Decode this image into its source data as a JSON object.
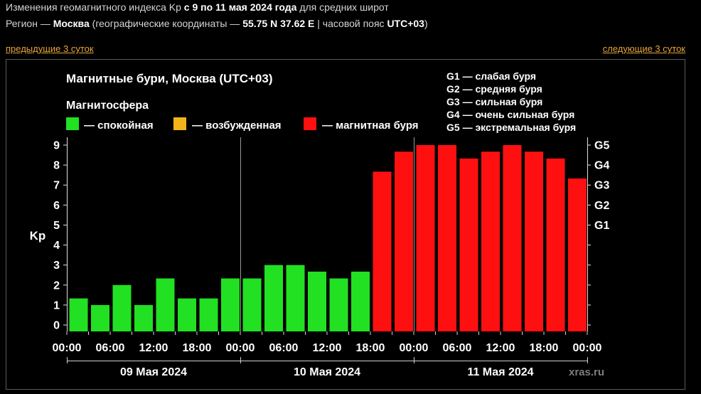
{
  "header": {
    "intro": "Изменения геомагнитного индекса Kp ",
    "period": "с 9 по 11 мая 2024 года",
    "latitudes": " для средних широт",
    "region_label": "Регион — ",
    "region": "Москва",
    "coords_label": " (географические координаты — ",
    "coords": "55.75 N 37.62 E",
    "tz_label": " | часовой пояс ",
    "timezone": "UTC+03",
    "close": ")"
  },
  "nav": {
    "prev": "предыдущие 3 суток",
    "next": "следующие 3 суток"
  },
  "chart_data": {
    "type": "bar",
    "title": "Магнитные бури, Москва (UTC+03)",
    "ylabel": "Kp",
    "ylim": [
      0,
      9
    ],
    "yticks": [
      0,
      1,
      2,
      3,
      4,
      5,
      6,
      7,
      8,
      9
    ],
    "y2ticks": [
      {
        "value": 5,
        "label": "G1"
      },
      {
        "value": 6,
        "label": "G2"
      },
      {
        "value": 7,
        "label": "G3"
      },
      {
        "value": 8,
        "label": "G4"
      },
      {
        "value": 9,
        "label": "G5"
      }
    ],
    "legend": {
      "title": "Магнитосфера",
      "position": "top-left",
      "items": [
        {
          "label": "— спокойная",
          "color": "#22e022"
        },
        {
          "label": "— возбужденная",
          "color": "#f3b41b"
        },
        {
          "label": "— магнитная буря",
          "color": "#ff1010"
        }
      ]
    },
    "scale_legend": [
      "G1 — слабая буря",
      "G2 — средняя буря",
      "G3 — сильная буря",
      "G4 — очень сильная буря",
      "G5 — экстремальная буря"
    ],
    "xtick_labels": [
      "00:00",
      "06:00",
      "12:00",
      "18:00",
      "00:00",
      "06:00",
      "12:00",
      "18:00",
      "00:00",
      "06:00",
      "12:00",
      "18:00",
      "00:00"
    ],
    "grid": false,
    "days": [
      {
        "label": "09 Мая 2024",
        "kp": [
          1.33,
          1.0,
          2.0,
          1.0,
          2.33,
          1.33,
          1.33,
          2.33
        ],
        "colors": [
          "#22e022",
          "#22e022",
          "#22e022",
          "#22e022",
          "#22e022",
          "#22e022",
          "#22e022",
          "#22e022"
        ]
      },
      {
        "label": "10 Мая 2024",
        "kp": [
          2.33,
          3.0,
          3.0,
          2.67,
          2.33,
          2.67,
          7.67,
          8.67
        ],
        "colors": [
          "#22e022",
          "#22e022",
          "#22e022",
          "#22e022",
          "#22e022",
          "#22e022",
          "#ff1010",
          "#ff1010"
        ]
      },
      {
        "label": "11 Мая 2024",
        "kp": [
          9.0,
          9.0,
          8.33,
          8.67,
          9.0,
          8.67,
          8.33,
          7.33
        ],
        "colors": [
          "#ff1010",
          "#ff1010",
          "#ff1010",
          "#ff1010",
          "#ff1010",
          "#ff1010",
          "#ff1010",
          "#ff1010"
        ]
      }
    ]
  },
  "watermark": "xras.ru"
}
